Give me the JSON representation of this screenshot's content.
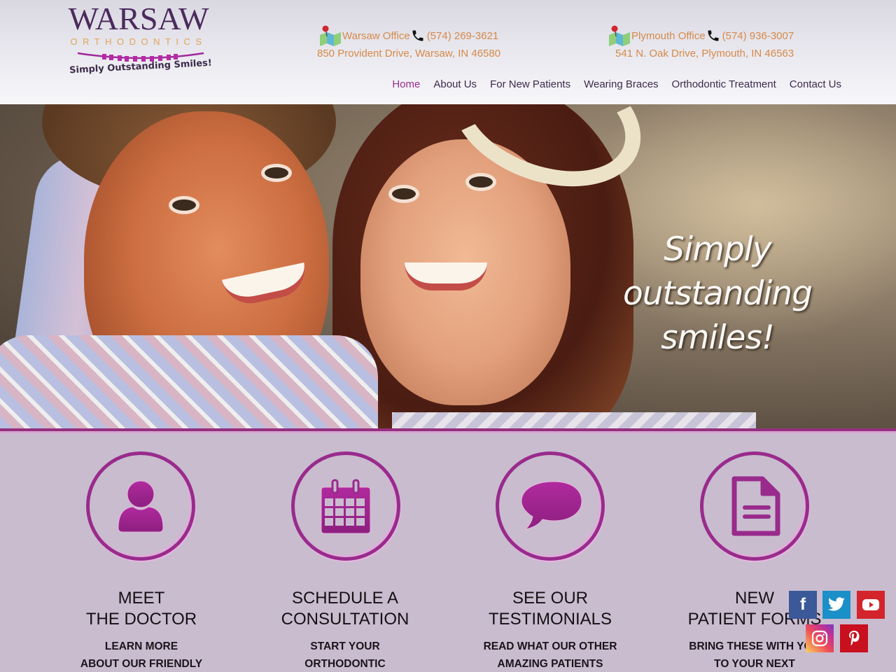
{
  "logo": {
    "name": "WARSAW",
    "subtitle": "ORTHODONTICS",
    "tagline": "Simply Outstanding Smiles!"
  },
  "offices": [
    {
      "name": "Warsaw Office",
      "phone": "(574) 269-3621",
      "address": "850 Provident Drive, Warsaw, IN 46580"
    },
    {
      "name": "Plymouth Office",
      "phone": "(574) 936-3007",
      "address": "541 N. Oak Drive, Plymouth, IN 46563"
    }
  ],
  "nav": {
    "items": [
      {
        "label": "Home",
        "active": true
      },
      {
        "label": "About Us"
      },
      {
        "label": "For New Patients"
      },
      {
        "label": "Wearing Braces"
      },
      {
        "label": "Orthodontic Treatment"
      },
      {
        "label": "Contact Us"
      }
    ]
  },
  "hero": {
    "line1": "Simply",
    "line2": "outstanding",
    "line3": "smiles!"
  },
  "features": [
    {
      "icon": "user-icon",
      "title1": "MEET",
      "title2": "THE DOCTOR",
      "desc1": "LEARN MORE",
      "desc2": "ABOUT OUR FRIENDLY"
    },
    {
      "icon": "calendar-icon",
      "title1": "SCHEDULE A",
      "title2": "CONSULTATION",
      "desc1": "START YOUR",
      "desc2": "ORTHODONTIC"
    },
    {
      "icon": "speech-bubble-icon",
      "title1": "SEE OUR",
      "title2": "TESTIMONIALS",
      "desc1": "READ WHAT OUR OTHER",
      "desc2": "AMAZING PATIENTS"
    },
    {
      "icon": "document-icon",
      "title1": "NEW",
      "title2": "PATIENT FORMS",
      "desc1": "BRING THESE WITH YOU",
      "desc2": "TO YOUR NEXT"
    }
  ],
  "social": [
    {
      "name": "facebook",
      "glyph": "f",
      "color": "#3b5998"
    },
    {
      "name": "twitter",
      "color": "#1a8fc8"
    },
    {
      "name": "youtube",
      "color": "#d3242b"
    },
    {
      "name": "instagram"
    },
    {
      "name": "pinterest",
      "glyph": "P",
      "color": "#c8101f"
    }
  ],
  "colors": {
    "brand_purple": "#992b8c",
    "nav_active": "#9c2b8e",
    "office_text": "#d58a49",
    "feature_bg": "#c9bccf"
  }
}
